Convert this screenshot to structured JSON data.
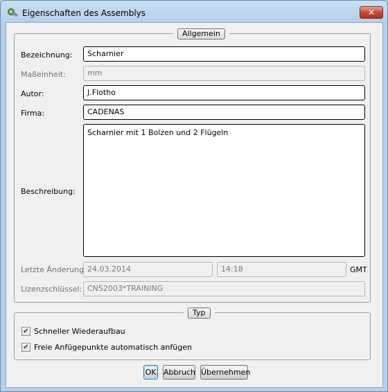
{
  "window": {
    "title": "Eigenschaften des Assemblys",
    "close_label": "✕"
  },
  "general": {
    "legend": "Allgemein",
    "bezeichnung": {
      "label": "Bezeichnung:",
      "value": "Scharnier"
    },
    "masseinheit": {
      "label": "Maßeinheit:",
      "value": "mm"
    },
    "autor": {
      "label": "Autor:",
      "value": "J.Flotho"
    },
    "firma": {
      "label": "Firma:",
      "value": "CADENAS"
    },
    "beschreibung": {
      "label": "Beschreibung:",
      "value": "Scharnier mit 1 Bolzen und 2 Flügeln"
    },
    "letzte_aenderung": {
      "label": "Letzte Änderung:",
      "date": "24.03.2014",
      "time": "14:18",
      "zone": "GMT"
    },
    "lizenz": {
      "label": "Lizenzschlüssel:",
      "value": "CNS2003*TRAINING"
    }
  },
  "typ": {
    "legend": "Typ",
    "options": [
      {
        "label": "Schneller Wiederaufbau",
        "checked": true
      },
      {
        "label": "Freie Anfügepunkte automatisch anfügen",
        "checked": true
      }
    ]
  },
  "buttons": {
    "ok": "OK",
    "cancel": "Abbruch",
    "apply": "Übernehmen"
  },
  "icons": {
    "title_icon": "assembly-icon",
    "close_icon": "close-icon",
    "check_icon": "checkmark-icon"
  }
}
